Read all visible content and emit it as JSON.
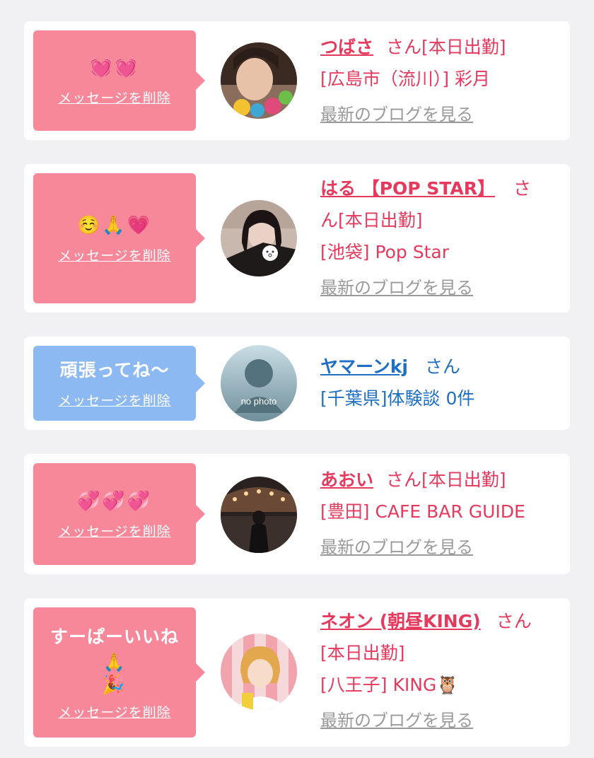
{
  "colors": {
    "pink_bubble": "#f7889a",
    "blue_bubble": "#8db9f3",
    "pink_text": "#e5395d",
    "blue_text": "#1f6fc4",
    "link_gray": "#9a9a9a"
  },
  "items": [
    {
      "message": "💓💓",
      "delete_label": "メッセージを削除",
      "name": "つばさ",
      "san": "さん",
      "status": "[本日出勤]",
      "shop": "[広島市（流川）] 彩月",
      "blog": "最新のブログを見る"
    },
    {
      "message": "☺️🙏💗",
      "delete_label": "メッセージを削除",
      "name": "はる 【POP STAR】",
      "san": "さ",
      "san2": "ん",
      "status": "[本日出勤]",
      "shop": "[池袋] Pop Star",
      "blog": "最新のブログを見る"
    },
    {
      "message": "頑張ってね〜",
      "delete_label": "メッセージを削除",
      "name": "ヤマーンkj",
      "san": "さん",
      "shop": "[千葉県]体験談 0件",
      "avatar_text": "no photo"
    },
    {
      "message": "💞💞💞",
      "delete_label": "メッセージを削除",
      "name": "あおい",
      "san": "さん",
      "status": "[本日出勤]",
      "shop": "[豊田] CAFE BAR GUIDE",
      "blog": "最新のブログを見る"
    },
    {
      "message": "すーぱーいいね🙏",
      "message2": "🎉",
      "delete_label": "メッセージを削除",
      "name": "ネオン (朝昼KING)",
      "san": "さん",
      "status": "[本日出勤]",
      "shop": "[八王子] KING🦉",
      "blog": "最新のブログを見る"
    }
  ]
}
